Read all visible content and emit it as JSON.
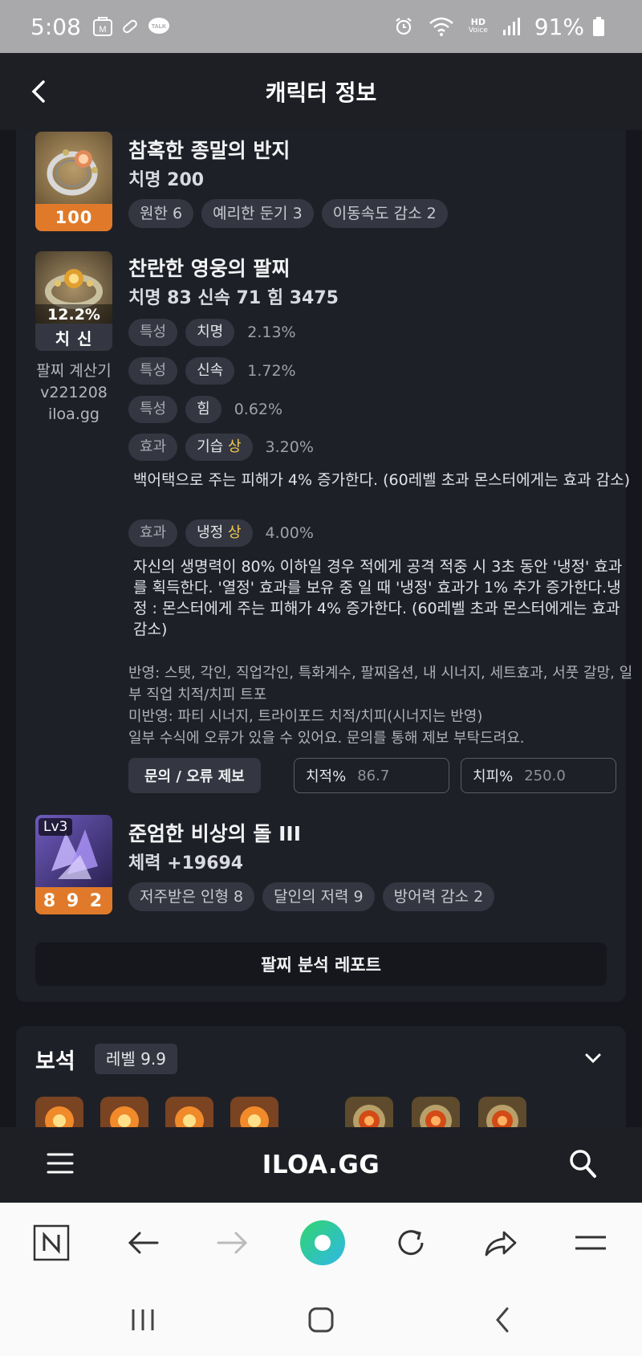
{
  "status_bar": {
    "time": "5:08",
    "talk_label": "TALK",
    "m_label": "M",
    "hd_label": "HD",
    "voice_label": "Voice",
    "battery": "91%"
  },
  "header": {
    "title": "캐릭터 정보"
  },
  "ring": {
    "name": "참혹한 종말의 반지",
    "stat": "치명 200",
    "quality": "100",
    "tags": [
      "원한 6",
      "예리한 둔기 3",
      "이동속도 감소 2"
    ]
  },
  "bracelet": {
    "name": "찬란한 영웅의 팔찌",
    "stat": "치명 83  신속 71  힘 3475",
    "thumb_pct": "12.2%",
    "thumb_label": "치 신",
    "calc_lines": [
      "팔찌 계산기",
      "v221208",
      "iloa.gg"
    ],
    "lines": [
      {
        "kind": "특성",
        "name": "치명",
        "grade": "",
        "pct": "2.13%"
      },
      {
        "kind": "특성",
        "name": "신속",
        "grade": "",
        "pct": "1.72%"
      },
      {
        "kind": "특성",
        "name": "힘",
        "grade": "",
        "pct": "0.62%"
      },
      {
        "kind": "효과",
        "name": "기습",
        "grade": "상",
        "pct": "3.20%"
      },
      {
        "kind": "효과",
        "name": "냉정",
        "grade": "상",
        "pct": "4.00%"
      }
    ],
    "desc1": "백어택으로 주는 피해가 4% 증가한다. (60레벨 초과 몬스터에게는 효과 감소)",
    "desc2": "자신의 생명력이 80% 이하일 경우 적에게 공격 적중 시 3초 동안 '냉정' 효과를 획득한다. '열정' 효과를 보유 중 일 때 '냉정' 효과가 1% 추가 증가한다.냉정 : 몬스터에게 주는 피해가 4% 증가한다. (60레벨 초과 몬스터에게는 효과 감소)",
    "notes": [
      "반영: 스탯, 각인, 직업각인, 특화계수, 팔찌옵션, 내 시너지, 세트효과, 서풋 갈망, 일부 직업 치적/치피 트포",
      "미반영: 파티 시너지, 트라이포드 치적/치피(시너지는 반영)",
      "일부 수식에 오류가 있을 수 있어요. 문의를 통해 제보 부탁드려요."
    ],
    "report_button": "문의 / 오류 제보",
    "crit_rate_label": "치적%",
    "crit_rate_value": "86.7",
    "crit_dmg_label": "치피%",
    "crit_dmg_value": "250.0"
  },
  "stone": {
    "level_badge": "Lv3",
    "name": "준엄한 비상의 돌 III",
    "stat": "체력 +19694",
    "quality": "8 9 2",
    "tags": [
      "저주받은 인형 8",
      "달인의 저력 9",
      "방어력 감소 2"
    ]
  },
  "analysis_button": "팔찌 분석 레포트",
  "gems": {
    "title": "보석",
    "level": "레벨 9.9"
  },
  "site": {
    "logo": "ILOA.GG"
  },
  "colors": {
    "accent_orange": "#e07a2a",
    "grade_gold": "#f2c94c",
    "background": "#1a1c22"
  }
}
